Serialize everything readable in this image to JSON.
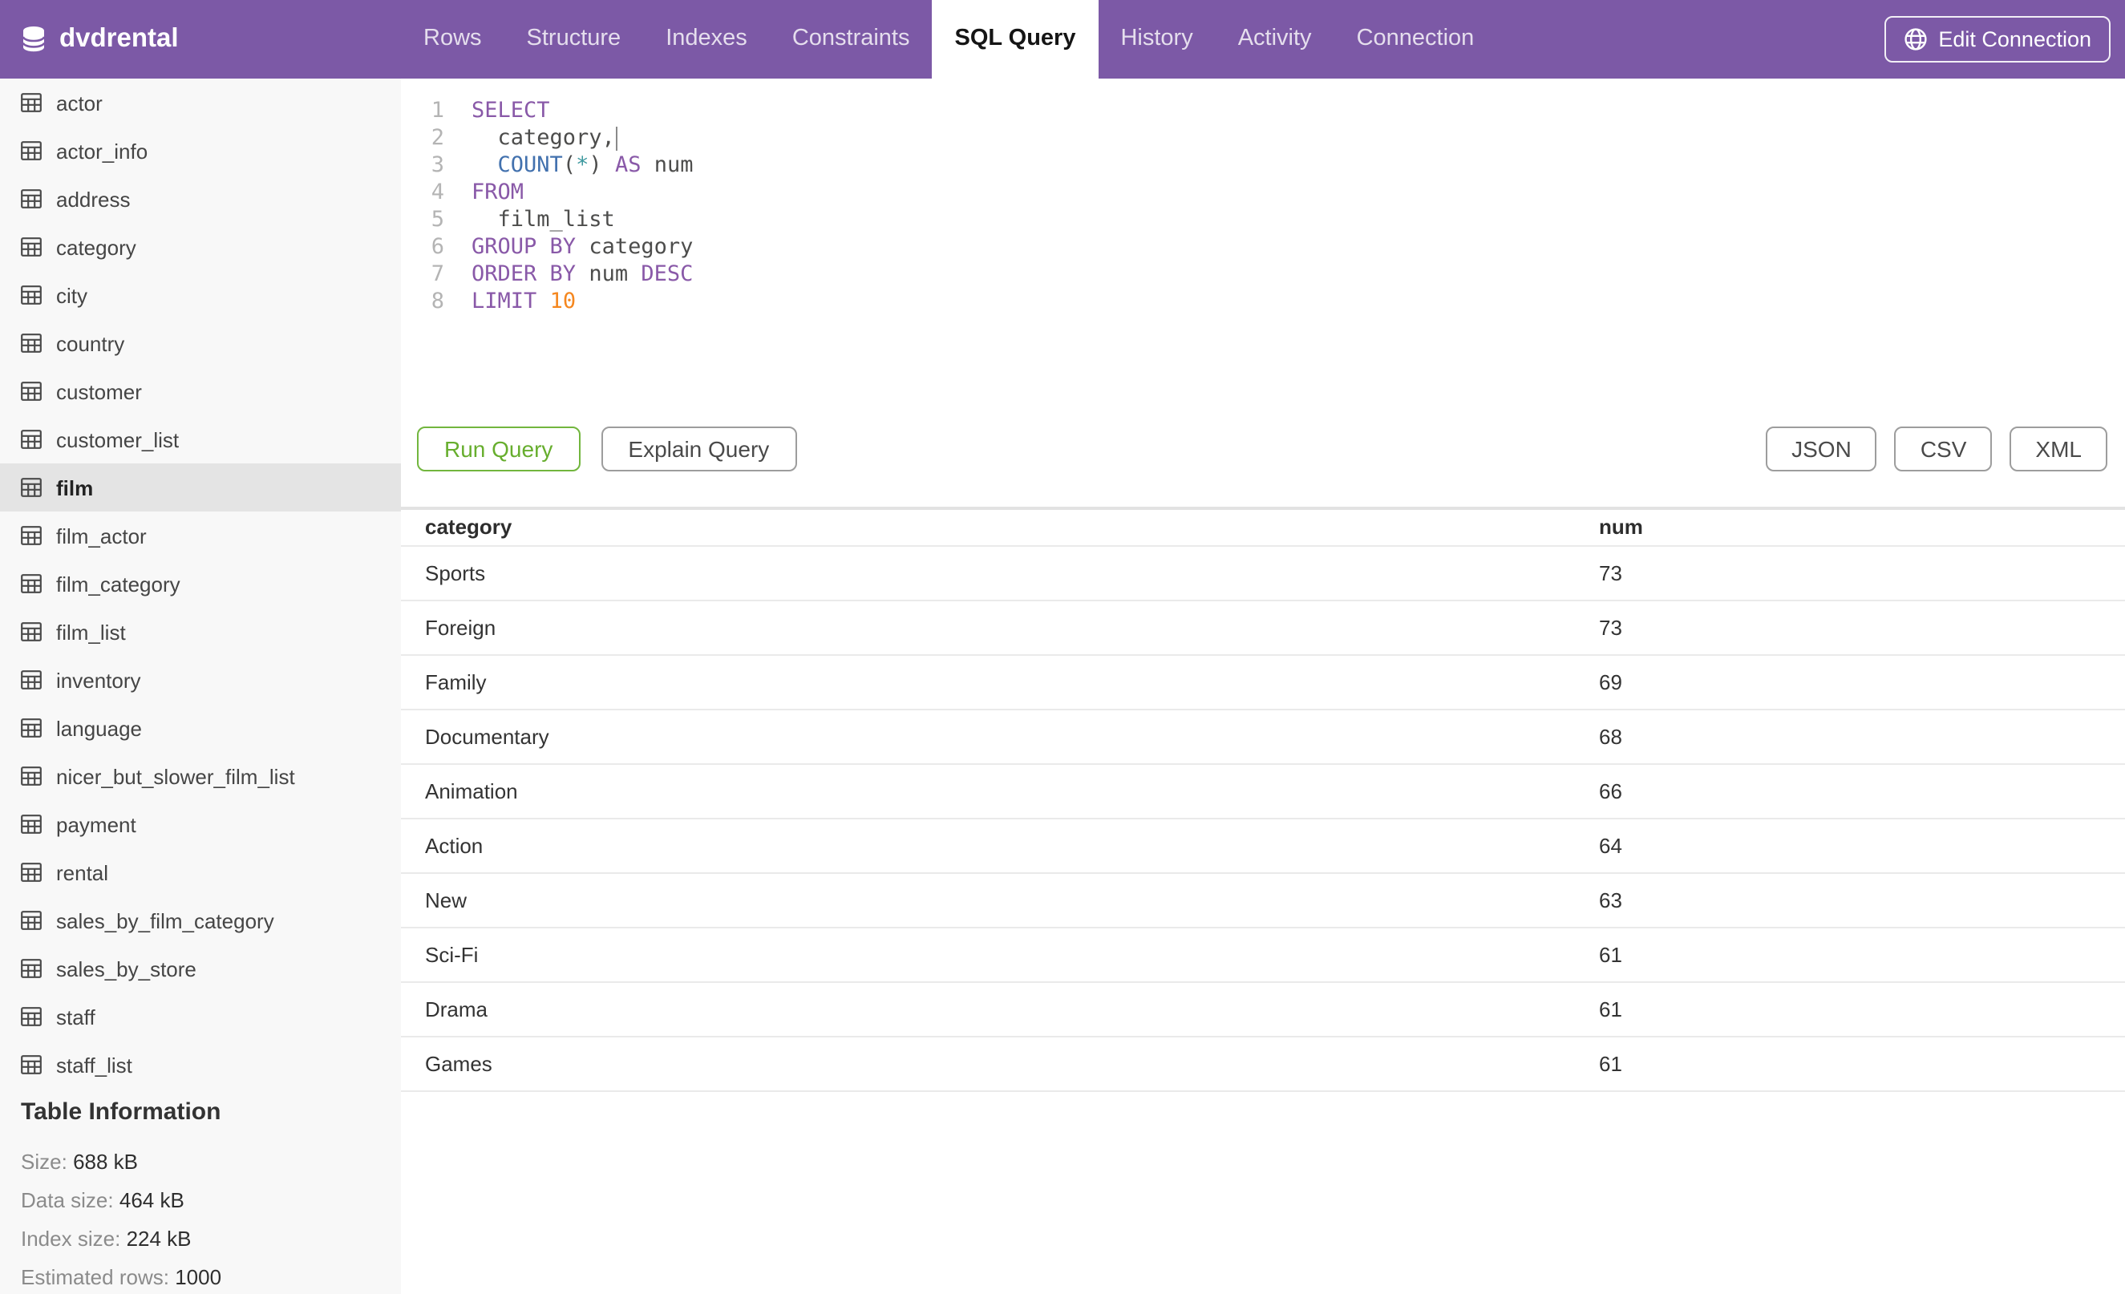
{
  "header": {
    "database": "dvdrental",
    "tabs": [
      {
        "label": "Rows"
      },
      {
        "label": "Structure"
      },
      {
        "label": "Indexes"
      },
      {
        "label": "Constraints"
      },
      {
        "label": "SQL Query",
        "active": true
      },
      {
        "label": "History"
      },
      {
        "label": "Activity"
      },
      {
        "label": "Connection"
      }
    ],
    "edit_connection_label": "Edit Connection"
  },
  "sidebar": {
    "tables": [
      {
        "name": "actor"
      },
      {
        "name": "actor_info"
      },
      {
        "name": "address"
      },
      {
        "name": "category"
      },
      {
        "name": "city"
      },
      {
        "name": "country"
      },
      {
        "name": "customer"
      },
      {
        "name": "customer_list"
      },
      {
        "name": "film",
        "selected": true
      },
      {
        "name": "film_actor"
      },
      {
        "name": "film_category"
      },
      {
        "name": "film_list"
      },
      {
        "name": "inventory"
      },
      {
        "name": "language"
      },
      {
        "name": "nicer_but_slower_film_list"
      },
      {
        "name": "payment"
      },
      {
        "name": "rental"
      },
      {
        "name": "sales_by_film_category"
      },
      {
        "name": "sales_by_store"
      },
      {
        "name": "staff"
      },
      {
        "name": "staff_list"
      }
    ],
    "table_info": {
      "title": "Table Information",
      "rows": [
        {
          "label": "Size:",
          "value": "688 kB"
        },
        {
          "label": "Data size:",
          "value": "464 kB"
        },
        {
          "label": "Index size:",
          "value": "224 kB"
        },
        {
          "label": "Estimated rows:",
          "value": "1000"
        }
      ]
    }
  },
  "editor": {
    "lines": [
      {
        "num": 1,
        "tokens": [
          {
            "text": "SELECT",
            "type": "keyword"
          }
        ]
      },
      {
        "num": 2,
        "tokens": [
          {
            "text": "  category,",
            "type": "plain"
          }
        ],
        "cursor_after": true
      },
      {
        "num": 3,
        "tokens": [
          {
            "text": "  ",
            "type": "plain"
          },
          {
            "text": "COUNT",
            "type": "function"
          },
          {
            "text": "(",
            "type": "plain"
          },
          {
            "text": "*",
            "type": "operator"
          },
          {
            "text": ")",
            "type": "plain"
          },
          {
            "text": " ",
            "type": "plain"
          },
          {
            "text": "AS",
            "type": "keyword"
          },
          {
            "text": " num",
            "type": "plain"
          }
        ]
      },
      {
        "num": 4,
        "tokens": [
          {
            "text": "FROM",
            "type": "keyword"
          }
        ]
      },
      {
        "num": 5,
        "tokens": [
          {
            "text": "  film_list",
            "type": "plain"
          }
        ]
      },
      {
        "num": 6,
        "tokens": [
          {
            "text": "GROUP BY",
            "type": "keyword"
          },
          {
            "text": " category",
            "type": "plain"
          }
        ]
      },
      {
        "num": 7,
        "tokens": [
          {
            "text": "ORDER BY",
            "type": "keyword"
          },
          {
            "text": " num ",
            "type": "plain"
          },
          {
            "text": "DESC",
            "type": "keyword"
          }
        ]
      },
      {
        "num": 8,
        "tokens": [
          {
            "text": "LIMIT",
            "type": "keyword"
          },
          {
            "text": " ",
            "type": "plain"
          },
          {
            "text": "10",
            "type": "number"
          }
        ]
      }
    ]
  },
  "toolbar": {
    "run_label": "Run Query",
    "explain_label": "Explain Query",
    "exports": [
      {
        "label": "JSON"
      },
      {
        "label": "CSV"
      },
      {
        "label": "XML"
      }
    ]
  },
  "results": {
    "columns": {
      "category": "category",
      "num": "num"
    },
    "rows": [
      {
        "category": "Sports",
        "num": "73"
      },
      {
        "category": "Foreign",
        "num": "73"
      },
      {
        "category": "Family",
        "num": "69"
      },
      {
        "category": "Documentary",
        "num": "68"
      },
      {
        "category": "Animation",
        "num": "66"
      },
      {
        "category": "Action",
        "num": "64"
      },
      {
        "category": "New",
        "num": "63"
      },
      {
        "category": "Sci-Fi",
        "num": "61"
      },
      {
        "category": "Drama",
        "num": "61"
      },
      {
        "category": "Games",
        "num": "61"
      }
    ]
  },
  "colors": {
    "header_purple": "#7c59a6",
    "accent_green": "#72b63e",
    "sql_keyword": "#8959a8",
    "sql_function": "#4271ae",
    "sql_operator": "#3e999f",
    "sql_number": "#f5871f",
    "selected_row_bg": "#e4e4e4"
  }
}
